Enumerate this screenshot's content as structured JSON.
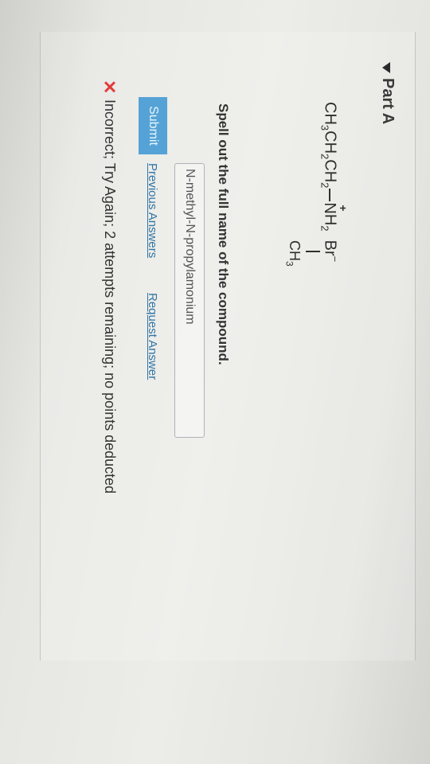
{
  "part": {
    "title": "Part A"
  },
  "formula": {
    "chain": "CH",
    "sub3": "3",
    "ch": "CH",
    "sub2a": "2",
    "ch2": "CH",
    "sub2b": "2",
    "n": "N",
    "h": "H",
    "sub2c": "2",
    "plus": "+",
    "counter_ion": "Br",
    "minus": "−",
    "branch": "CH",
    "branch_sub": "3"
  },
  "question": {
    "prompt": "Spell out the full name of the compound."
  },
  "answer": {
    "value": "N-methyl-N-propylamonium"
  },
  "actions": {
    "submit_label": "Submit",
    "previous_answers_label": "Previous Answers",
    "request_answer_label": "Request Answer"
  },
  "feedback": {
    "icon": "x-mark-icon",
    "message": "Incorrect; Try Again; 2 attempts remaining; no points deducted",
    "icon_color": "#e33a3a"
  },
  "colors": {
    "submit_bg": "#55a3d6",
    "link": "#2f75a6"
  }
}
